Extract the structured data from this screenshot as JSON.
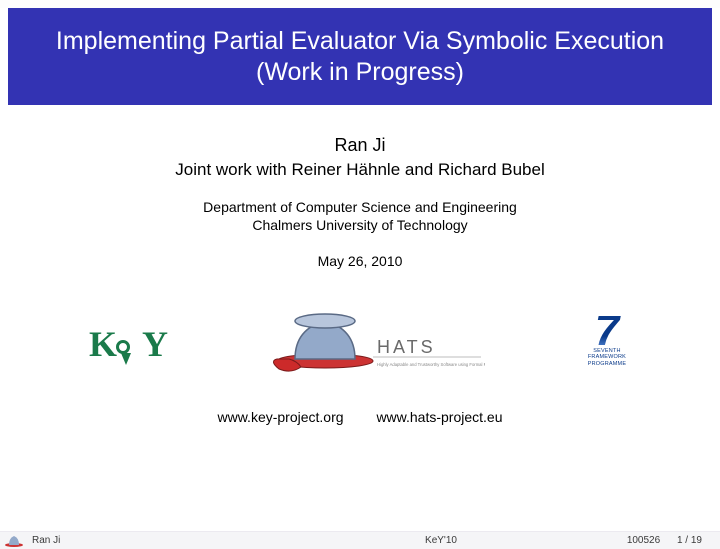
{
  "title": {
    "line1": "Implementing Partial Evaluator Via Symbolic Execution",
    "line2": "(Work in Progress)"
  },
  "author": "Ran Ji",
  "joint_line": "Joint work with Reiner Hähnle and Richard Bubel",
  "department_line1": "Department of Computer Science and Engineering",
  "department_line2": "Chalmers University of Technology",
  "date": "May 26, 2010",
  "logos": {
    "key": "KeY",
    "hats_name": "HATS",
    "hats_tag": "Highly Adaptable and Trustworthy Software using Formal Models",
    "fp7_line1": "SEVENTH FRAMEWORK",
    "fp7_line2": "PROGRAMME"
  },
  "urls": {
    "key": "www.key-project.org",
    "hats": "www.hats-project.eu"
  },
  "footer": {
    "author": "Ran Ji",
    "center": "KeY'10",
    "date": "100526",
    "page": "1 / 19"
  }
}
